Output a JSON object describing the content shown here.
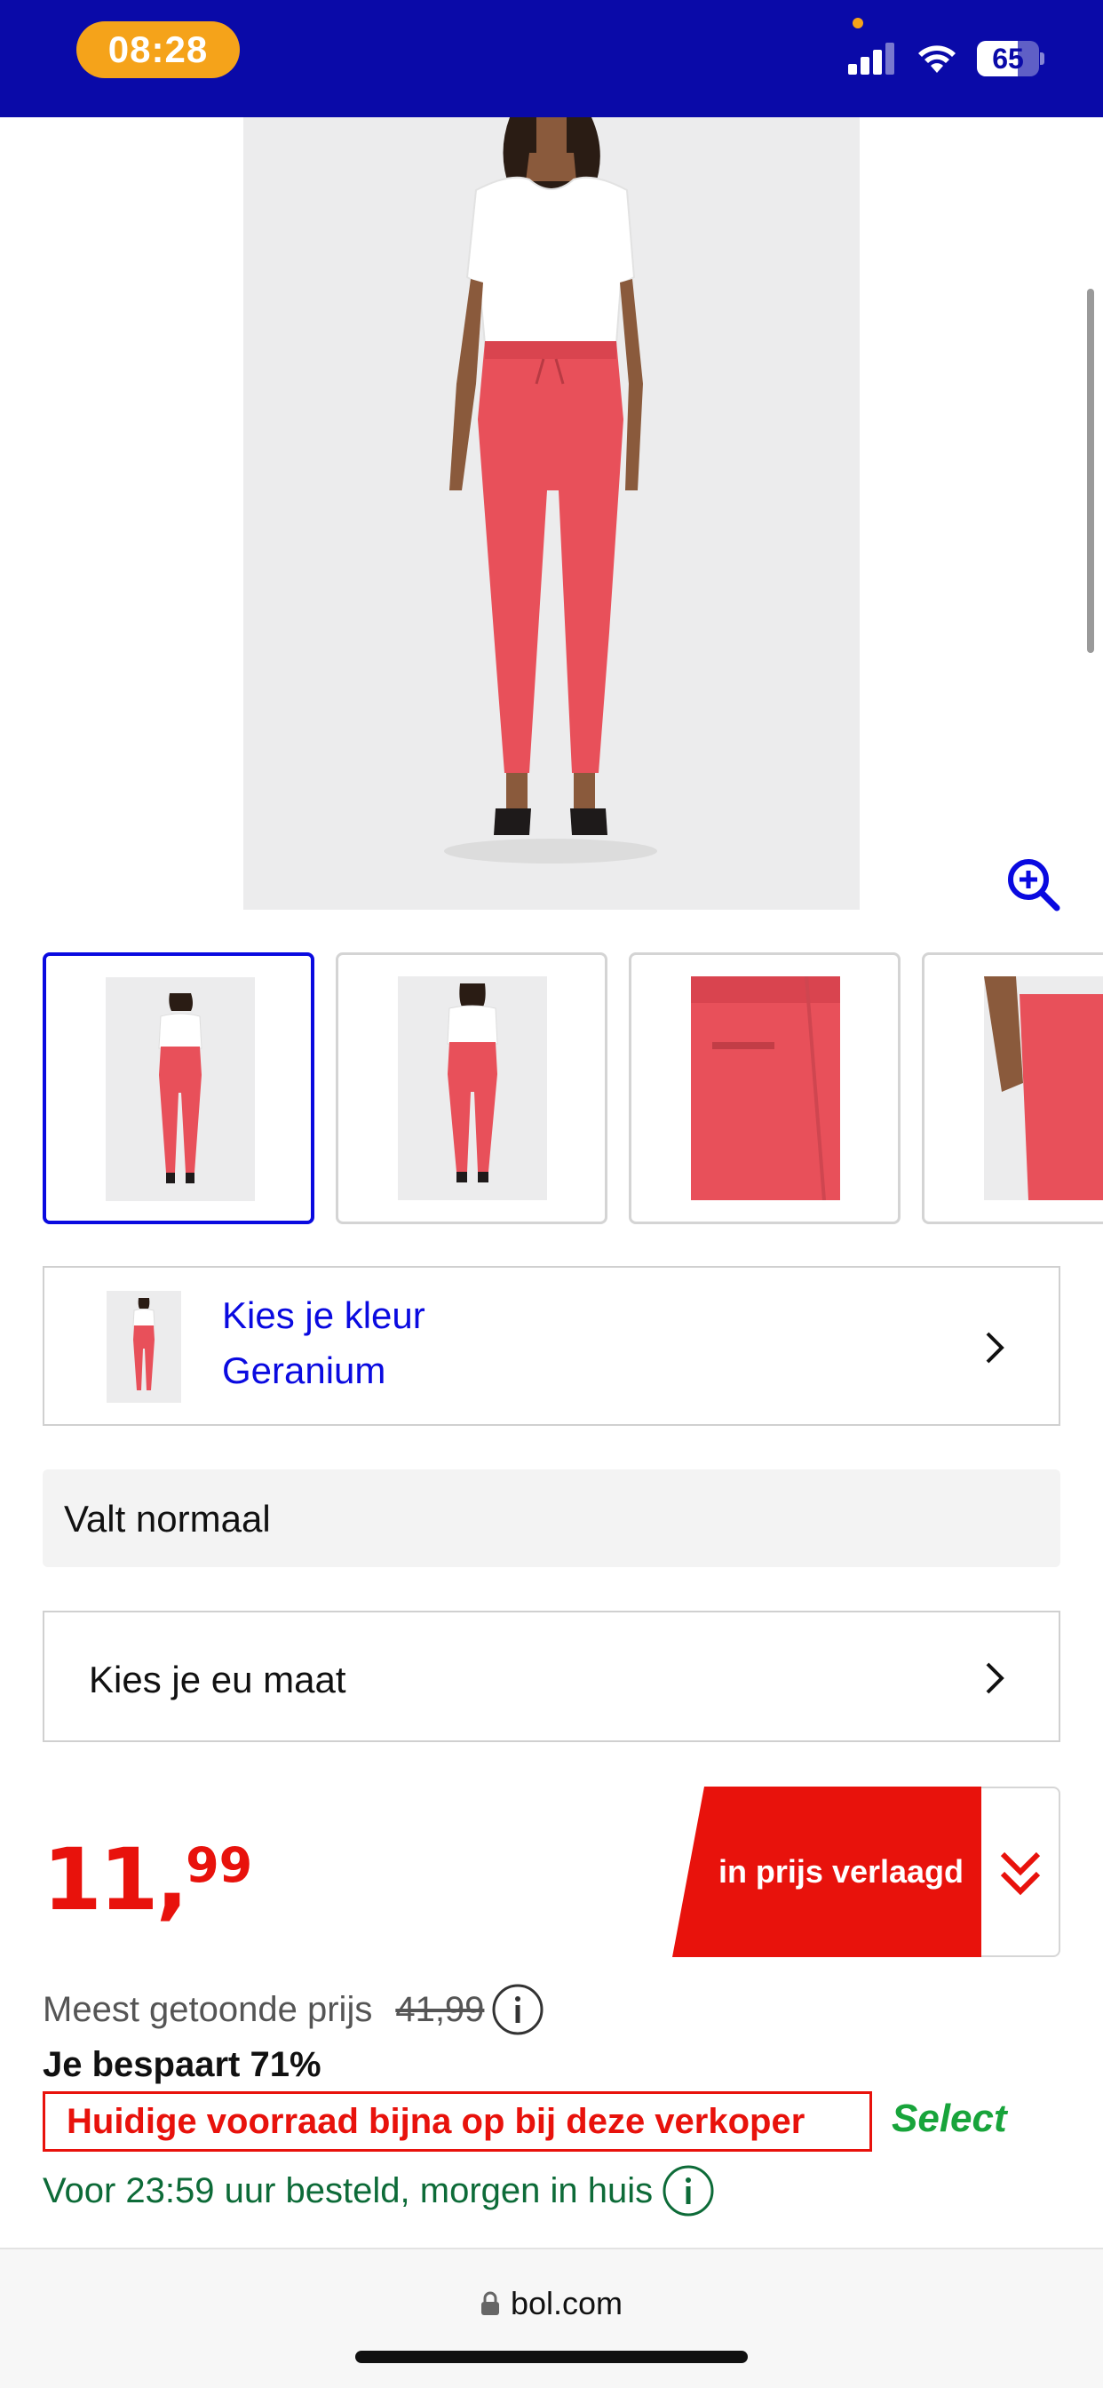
{
  "status_bar": {
    "time": "08:28",
    "battery": "65",
    "battery_level": 0.65,
    "background_color": "#0a0aa8",
    "time_pill_color": "#f5a31a"
  },
  "product": {
    "main_image_alt": "Model in white top and geranium trousers",
    "zoom_icon": "zoom-in-icon",
    "thumbnails": [
      {
        "name": "front view",
        "selected": true
      },
      {
        "name": "back view",
        "selected": false
      },
      {
        "name": "pocket detail",
        "selected": false
      },
      {
        "name": "side detail",
        "selected": false
      }
    ],
    "color": {
      "label": "Kies je kleur",
      "value": "Geranium"
    },
    "fit": "Valt normaal",
    "size": {
      "label": "Kies je eu maat"
    }
  },
  "pricing": {
    "price_euros": "11",
    "price_cents": "99",
    "cta_label": "in prijs verlaagd",
    "meest_label": "Meest getoonde prijs",
    "old_price": "41,99",
    "savings": "Je bespaart 71%",
    "stock_warning": "Huidige voorraad bijna op bij deze verkoper",
    "select_label": "Select",
    "delivery": "Voor 23:59 uur besteld, morgen in huis"
  },
  "browser": {
    "url": "bol.com"
  },
  "colors": {
    "brand_blue": "#0a0ae0",
    "price_red": "#e8120c",
    "select_green": "#18a43b",
    "delivery_green": "#0d6b38",
    "pants": "#e8505a"
  }
}
